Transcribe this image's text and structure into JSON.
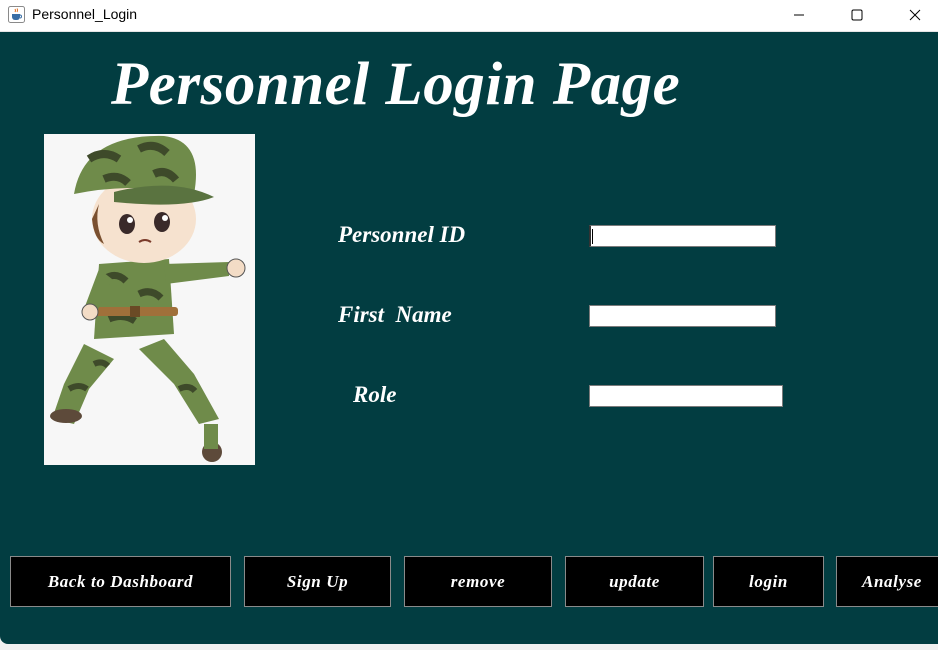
{
  "window": {
    "title": "Personnel_Login",
    "icon": "java-cup-icon",
    "controls": [
      "minimize-icon",
      "maximize-icon",
      "close-icon"
    ]
  },
  "page": {
    "heading": "Personnel Login Page",
    "image": "soldier-cartoon-illustration"
  },
  "form": {
    "personnel_id_label": "Personnel ID",
    "personnel_id_value": "",
    "first_name_label": "First  Name",
    "first_name_value": "",
    "role_label": "Role",
    "role_value": ""
  },
  "buttons": {
    "back": "Back to Dashboard",
    "signup": "Sign Up",
    "remove": "remove",
    "update": "update",
    "login": "login",
    "analyse": "Analyse"
  },
  "colors": {
    "background": "#023d41",
    "button_bg": "#000000",
    "text": "#ffffff"
  }
}
